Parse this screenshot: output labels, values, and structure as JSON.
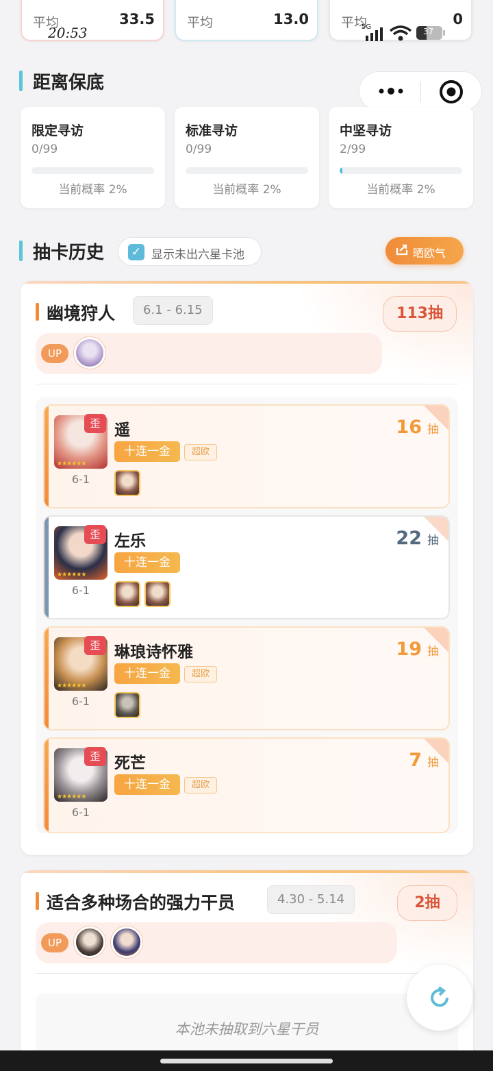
{
  "top_stats": [
    {
      "label": "平均",
      "value": "33.5",
      "accent": "#f7d4cc"
    },
    {
      "label": "平均",
      "value": "13.0",
      "accent": "#cde9f1"
    },
    {
      "label": "平均",
      "value": "0",
      "accent": "#e6e6e6"
    }
  ],
  "status_bar": {
    "time": "20:53",
    "network": "5G",
    "battery": "37"
  },
  "pity": {
    "title": "距离保底",
    "cards": [
      {
        "name": "限定寻访",
        "count": "0/99",
        "progress": 0,
        "rate": "当前概率 2%"
      },
      {
        "name": "标准寻访",
        "count": "0/99",
        "progress": 0,
        "rate": "当前概率 2%"
      },
      {
        "name": "中坚寻访",
        "count": "2/99",
        "progress": 0.02,
        "rate": "当前概率 2%"
      }
    ]
  },
  "history": {
    "title": "抽卡历史",
    "toggle_label": "显示未出六星卡池",
    "toggle_checked": true,
    "share_label": "晒欧气"
  },
  "pools": [
    {
      "name": "幽境狩人",
      "date": "6.1 - 6.15",
      "count": "113抽",
      "up_label": "UP",
      "pulls": [
        {
          "name": "遥",
          "wai": "歪",
          "stage": "6-1",
          "tag": "十连一金",
          "badge": "超欧",
          "count": "16",
          "unit": "抽",
          "style": "orange",
          "minis": 1
        },
        {
          "name": "左乐",
          "wai": "歪",
          "stage": "6-1",
          "tag": "十连一金",
          "badge": "",
          "count": "22",
          "unit": "抽",
          "style": "blue",
          "minis": 2
        },
        {
          "name": "琳琅诗怀雅",
          "wai": "歪",
          "stage": "6-1",
          "tag": "十连一金",
          "badge": "超欧",
          "count": "19",
          "unit": "抽",
          "style": "orange",
          "minis": 1
        },
        {
          "name": "死芒",
          "wai": "歪",
          "stage": "6-1",
          "tag": "十连一金",
          "badge": "超欧",
          "count": "7",
          "unit": "抽",
          "style": "orange",
          "minis": 0
        }
      ]
    },
    {
      "name": "适合多种场合的强力干员",
      "date": "4.30 - 5.14",
      "count": "2抽",
      "up_label": "UP",
      "empty_text": "本池未抽取到六星干员"
    }
  ],
  "icons": {
    "menu": "more-dots-icon",
    "close": "target-icon",
    "share": "share-icon",
    "refresh": "refresh-icon",
    "check": "checkmark-icon"
  },
  "colors": {
    "accent_teal": "#5fc4d8",
    "accent_orange": "#f08c3a",
    "danger": "#e54c54",
    "gold": "#f7a542"
  }
}
